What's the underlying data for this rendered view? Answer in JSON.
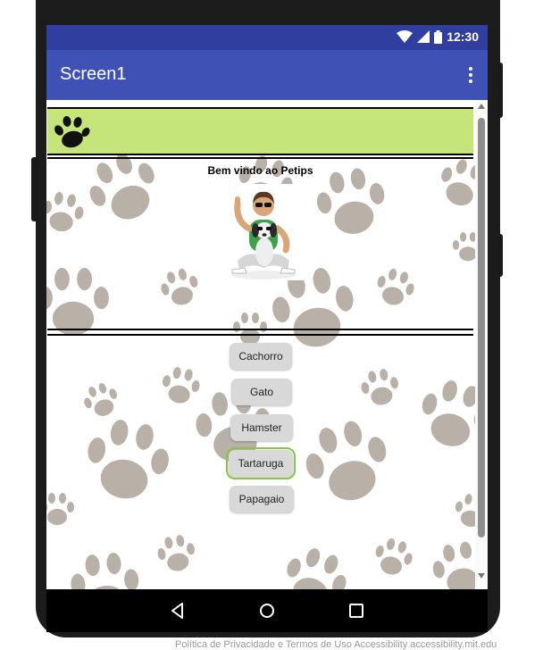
{
  "status_bar": {
    "time": "12:30",
    "icons": [
      "wifi-icon",
      "signal-icon",
      "battery-icon"
    ]
  },
  "app_bar": {
    "title": "Screen1",
    "menu_icon": "more-vert-icon"
  },
  "header": {
    "icon": "paw-icon"
  },
  "welcome": {
    "text": "Bem vindo ao Petips",
    "image": "person-with-dog-avatar"
  },
  "pet_buttons": [
    {
      "label": "Cachorro"
    },
    {
      "label": "Gato"
    },
    {
      "label": "Hamster"
    },
    {
      "label": "Tartaruga"
    },
    {
      "label": "Papagaio"
    }
  ],
  "nav_bar": {
    "icons": [
      "back-icon",
      "home-icon",
      "recents-icon"
    ]
  },
  "footer": {
    "text": "Política de Privacidade e Termos de Uso      Accessibility accessibility.mit.edu"
  },
  "colors": {
    "status_bar": "#303f9f",
    "app_bar": "#3f51b5",
    "header_bar": "#c5e479",
    "paw_pattern": "#b9b0a8",
    "focus": "#8bc34a"
  }
}
